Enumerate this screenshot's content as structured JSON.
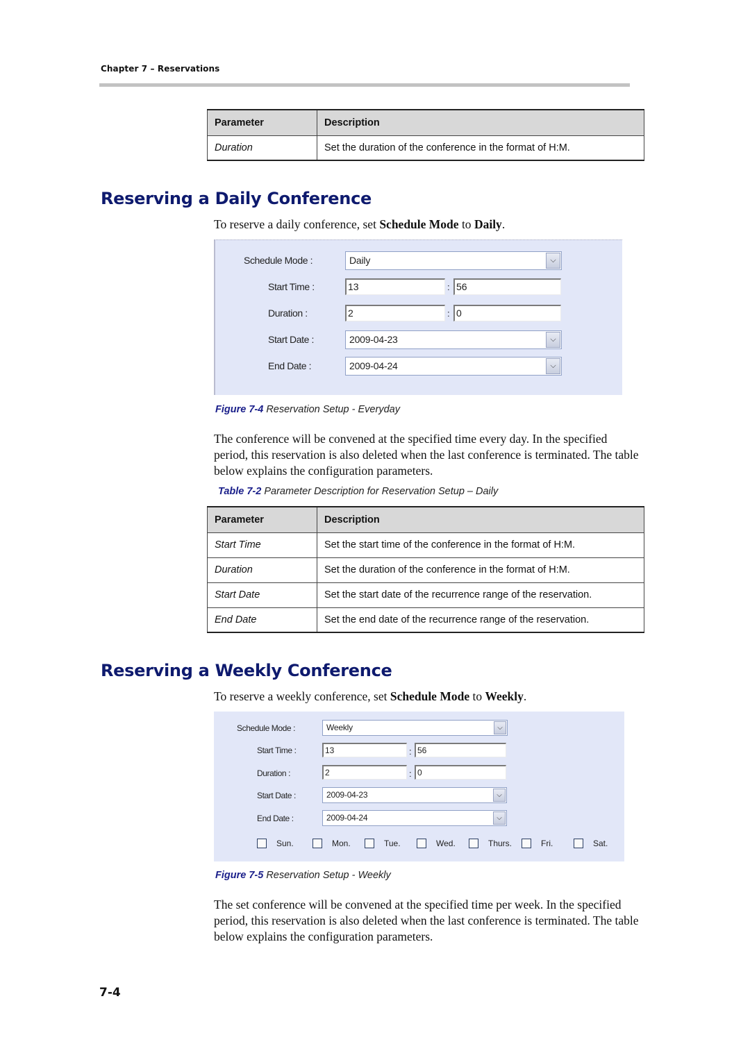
{
  "header": {
    "chapter": "Chapter 7 – Reservations"
  },
  "table_top": {
    "columns": [
      "Parameter",
      "Description"
    ],
    "rows": [
      {
        "param": "Duration",
        "desc": "Set the duration of the conference in the format of H:M."
      }
    ]
  },
  "daily_section": {
    "heading": "Reserving a Daily Conference",
    "intro_prefix": "To reserve a daily conference, set ",
    "intro_bold1": "Schedule Mode",
    "intro_mid": " to ",
    "intro_bold2": "Daily",
    "intro_suffix": ".",
    "form": {
      "schedule_mode_label": "Schedule Mode :",
      "schedule_mode_value": "Daily",
      "start_time_label": "Start Time :",
      "start_time_hour": "13",
      "start_time_minute": "56",
      "duration_label": "Duration :",
      "duration_hour": "2",
      "duration_minute": "0",
      "start_date_label": "Start Date :",
      "start_date_value": "2009-04-23",
      "end_date_label": "End Date :",
      "end_date_value": "2009-04-24",
      "colon": ":"
    },
    "figure_caption_num": "Figure 7-4",
    "figure_caption_text": " Reservation Setup - Everyday",
    "paragraph": "The conference will be convened at the specified time every day. In the specified period, this reservation is also deleted when the last conference is terminated. The table below explains the configuration parameters.",
    "table_caption_num": "Table 7-2",
    "table_caption_text": " Parameter Description for Reservation Setup – Daily",
    "table": {
      "columns": [
        "Parameter",
        "Description"
      ],
      "rows": [
        {
          "param": "Start Time",
          "desc": "Set the start time of the conference in the format of H:M."
        },
        {
          "param": "Duration",
          "desc": "Set the duration of the conference in the format of H:M."
        },
        {
          "param": "Start Date",
          "desc": "Set the start date of the recurrence range of the reservation."
        },
        {
          "param": "End Date",
          "desc": "Set the end date of the recurrence range of the reservation."
        }
      ]
    }
  },
  "weekly_section": {
    "heading": "Reserving a Weekly Conference",
    "intro_prefix": "To reserve a weekly conference, set ",
    "intro_bold1": "Schedule Mode",
    "intro_mid": " to ",
    "intro_bold2": "Weekly",
    "intro_suffix": ".",
    "form": {
      "schedule_mode_label": "Schedule Mode :",
      "schedule_mode_value": "Weekly",
      "start_time_label": "Start Time :",
      "start_time_hour": "13",
      "start_time_minute": "56",
      "duration_label": "Duration :",
      "duration_hour": "2",
      "duration_minute": "0",
      "start_date_label": "Start Date :",
      "start_date_value": "2009-04-23",
      "end_date_label": "End Date :",
      "end_date_value": "2009-04-24",
      "colon": ":",
      "days": [
        {
          "label": "Sun.",
          "checked": false
        },
        {
          "label": "Mon.",
          "checked": false
        },
        {
          "label": "Tue.",
          "checked": false
        },
        {
          "label": "Wed.",
          "checked": false
        },
        {
          "label": "Thurs.",
          "checked": false
        },
        {
          "label": "Fri.",
          "checked": false
        },
        {
          "label": "Sat.",
          "checked": false
        }
      ]
    },
    "figure_caption_num": "Figure 7-5",
    "figure_caption_text": " Reservation Setup - Weekly",
    "paragraph": "The set conference will be convened at the specified time per week. In the specified period, this reservation is also deleted when the last conference is terminated. The table below explains the configuration parameters."
  },
  "icons": {
    "dropdown_arrow": "chevron-down-icon"
  },
  "colors": {
    "heading": "#0e1a6e",
    "caption_num": "#1a1f8a",
    "panel_bg": "#e2e7f8",
    "table_header_bg": "#d8d8d8"
  },
  "footer": {
    "page_number": "7-4"
  }
}
